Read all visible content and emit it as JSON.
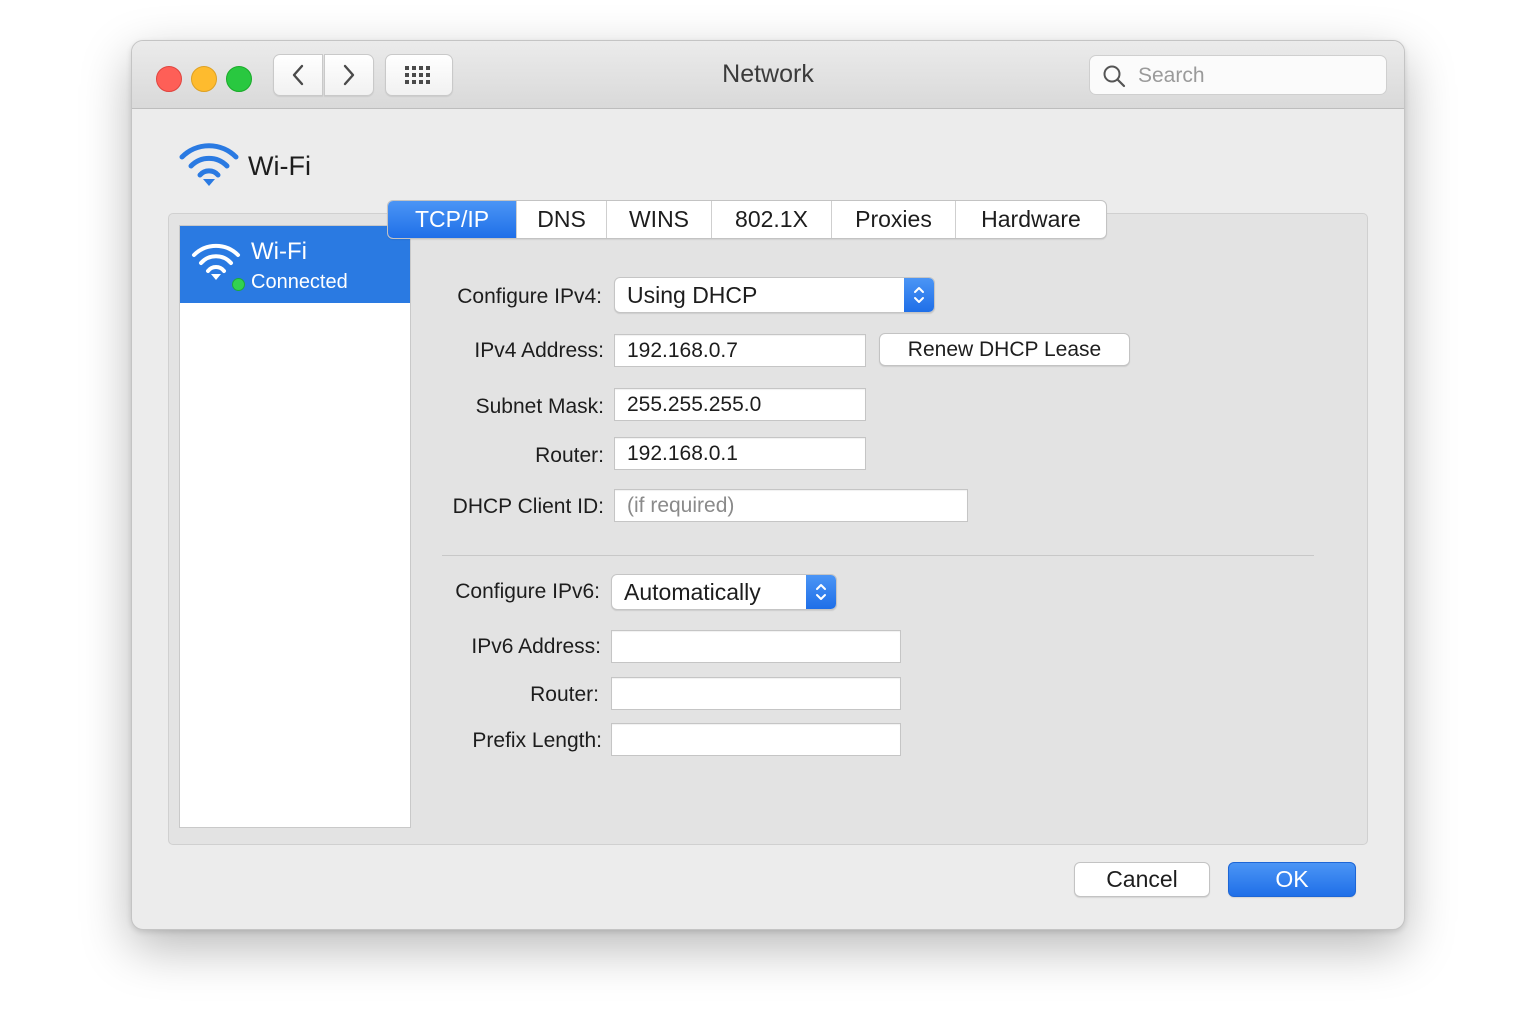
{
  "window": {
    "title": "Network"
  },
  "search": {
    "placeholder": "Search"
  },
  "header": {
    "title": "Wi-Fi",
    "icon": "wifi-icon"
  },
  "sidebar": {
    "items": [
      {
        "name": "Wi-Fi",
        "status": "Connected",
        "icon": "wifi-icon",
        "status_color": "#32d150"
      }
    ]
  },
  "tabs": [
    "TCP/IP",
    "DNS",
    "WINS",
    "802.1X",
    "Proxies",
    "Hardware"
  ],
  "active_tab": "TCP/IP",
  "ipv4": {
    "configure_label": "Configure IPv4:",
    "configure_value": "Using DHCP",
    "address_label": "IPv4 Address:",
    "address_value": "192.168.0.7",
    "renew_button": "Renew DHCP Lease",
    "subnet_label": "Subnet Mask:",
    "subnet_value": "255.255.255.0",
    "router_label": "Router:",
    "router_value": "192.168.0.1",
    "client_id_label": "DHCP Client ID:",
    "client_id_placeholder": "(if required)"
  },
  "ipv6": {
    "configure_label": "Configure IPv6:",
    "configure_value": "Automatically",
    "address_label": "IPv6 Address:",
    "address_value": "",
    "router_label": "Router:",
    "router_value": "",
    "prefix_label": "Prefix Length:",
    "prefix_value": ""
  },
  "footer": {
    "cancel": "Cancel",
    "ok": "OK"
  },
  "colors": {
    "accent": "#2a7ae2",
    "close": "#fe5f57",
    "minimize": "#febb2e",
    "maximize": "#29c840"
  }
}
